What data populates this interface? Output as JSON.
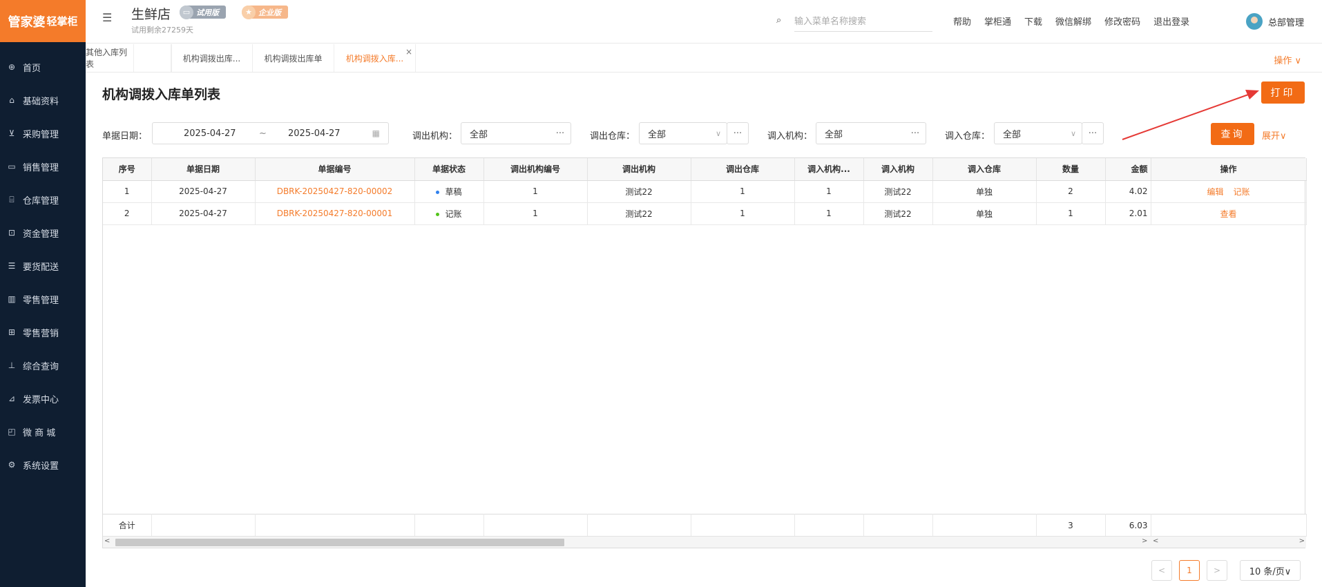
{
  "brand": {
    "logo_main": "管家婆",
    "logo_sub": "轻掌柜"
  },
  "sidebar": {
    "items": [
      {
        "label": "首页",
        "icon": "globe-icon"
      },
      {
        "label": "基础资料",
        "icon": "home-icon"
      },
      {
        "label": "采购管理",
        "icon": "cart-icon"
      },
      {
        "label": "销售管理",
        "icon": "card-icon"
      },
      {
        "label": "仓库管理",
        "icon": "warehouse-icon"
      },
      {
        "label": "资金管理",
        "icon": "money-icon"
      },
      {
        "label": "要货配送",
        "icon": "list-icon"
      },
      {
        "label": "零售管理",
        "icon": "chart-icon"
      },
      {
        "label": "零售营销",
        "icon": "gift-icon"
      },
      {
        "label": "综合查询",
        "icon": "bar-chart-icon"
      },
      {
        "label": "发票中心",
        "icon": "trend-icon"
      },
      {
        "label": "微 商 城",
        "icon": "bag-icon"
      },
      {
        "label": "系统设置",
        "icon": "gear-icon"
      }
    ]
  },
  "header": {
    "store_name": "生鲜店",
    "badge_trial": "试用版",
    "badge_enterprise": "企业版",
    "trial_left": "试用剩余27259天",
    "search_placeholder": "输入菜单名称搜索",
    "links": [
      "帮助",
      "掌柜通",
      "下载",
      "微信解绑",
      "修改密码",
      "退出登录"
    ],
    "user_name": "总部管理"
  },
  "tabs": {
    "items": [
      "其他入库列表",
      "机构调拨出库...",
      "机构调拨出库单",
      "机构调拨入库..."
    ],
    "active_index": 3,
    "close": "×",
    "ops_label": "操作 ∨"
  },
  "page": {
    "title": "机构调拨入库单列表",
    "print_label": "打印"
  },
  "filters": {
    "date_label": "单据日期：",
    "date_from": "2025-04-27",
    "date_sep": "~",
    "date_to": "2025-04-27",
    "out_org_label": "调出机构：",
    "out_org_value": "全部",
    "out_wh_label": "调出仓库：",
    "out_wh_value": "全部",
    "in_org_label": "调入机构：",
    "in_org_value": "全部",
    "in_wh_label": "调入仓库：",
    "in_wh_value": "全部",
    "query_label": "查询",
    "expand_label": "展开∨"
  },
  "table": {
    "columns": [
      "序号",
      "单据日期",
      "单据编号",
      "单据状态",
      "调出机构编号",
      "调出机构",
      "调出仓库",
      "调入机构...",
      "调入机构",
      "调入仓库",
      "数量",
      "金额",
      "操作"
    ],
    "rows": [
      {
        "idx": "1",
        "date": "2025-04-27",
        "no": "DBRK-20250427-820-00002",
        "status": "草稿",
        "status_color": "#2f80ed",
        "out_org_no": "1",
        "out_org": "测试22",
        "out_wh": "1",
        "in_org_no": "1",
        "in_org": "测试22",
        "in_wh": "单独",
        "qty": "2",
        "amount": "4.02",
        "ops": [
          "编辑",
          "记账"
        ]
      },
      {
        "idx": "2",
        "date": "2025-04-27",
        "no": "DBRK-20250427-820-00001",
        "status": "记账",
        "status_color": "#52c41a",
        "out_org_no": "1",
        "out_org": "测试22",
        "out_wh": "1",
        "in_org_no": "1",
        "in_org": "测试22",
        "in_wh": "单独",
        "qty": "1",
        "amount": "2.01",
        "ops": [
          "查看"
        ]
      }
    ],
    "total": {
      "label": "合计",
      "qty": "3",
      "amount": "6.03"
    }
  },
  "pager": {
    "prev": "<",
    "current": "1",
    "next": ">",
    "page_size": "10 条/页∨"
  },
  "colors": {
    "accent": "#f47b2a",
    "sidebar_bg": "#0f1e31",
    "annotation": "#e53935"
  }
}
